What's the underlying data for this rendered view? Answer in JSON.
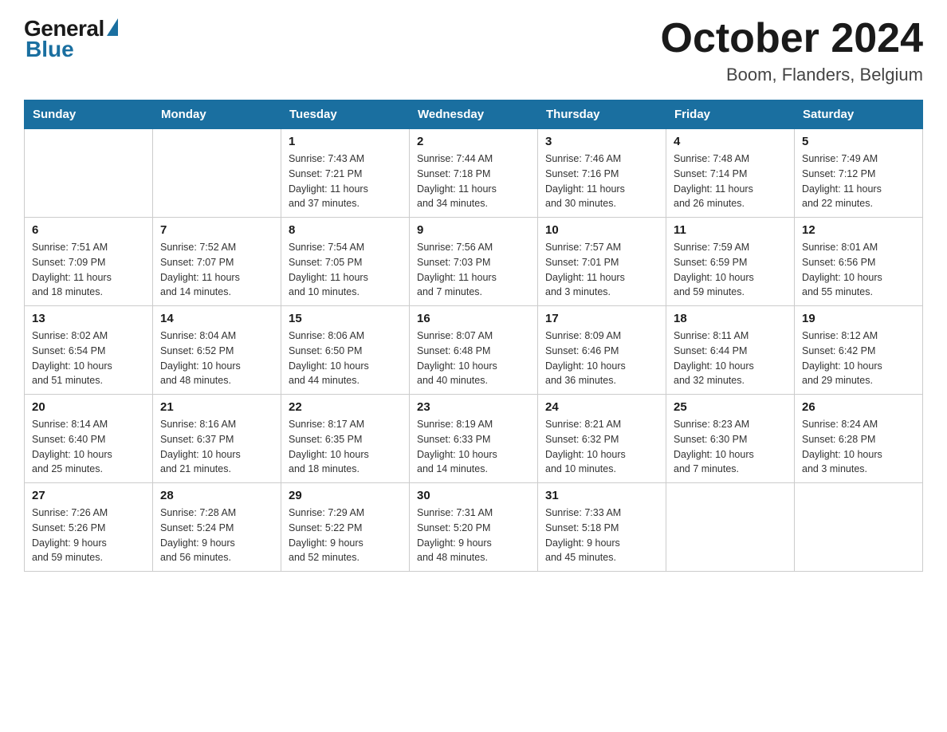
{
  "logo": {
    "general": "General",
    "blue": "Blue"
  },
  "header": {
    "month": "October 2024",
    "location": "Boom, Flanders, Belgium"
  },
  "weekdays": [
    "Sunday",
    "Monday",
    "Tuesday",
    "Wednesday",
    "Thursday",
    "Friday",
    "Saturday"
  ],
  "weeks": [
    [
      {
        "day": "",
        "info": ""
      },
      {
        "day": "",
        "info": ""
      },
      {
        "day": "1",
        "info": "Sunrise: 7:43 AM\nSunset: 7:21 PM\nDaylight: 11 hours\nand 37 minutes."
      },
      {
        "day": "2",
        "info": "Sunrise: 7:44 AM\nSunset: 7:18 PM\nDaylight: 11 hours\nand 34 minutes."
      },
      {
        "day": "3",
        "info": "Sunrise: 7:46 AM\nSunset: 7:16 PM\nDaylight: 11 hours\nand 30 minutes."
      },
      {
        "day": "4",
        "info": "Sunrise: 7:48 AM\nSunset: 7:14 PM\nDaylight: 11 hours\nand 26 minutes."
      },
      {
        "day": "5",
        "info": "Sunrise: 7:49 AM\nSunset: 7:12 PM\nDaylight: 11 hours\nand 22 minutes."
      }
    ],
    [
      {
        "day": "6",
        "info": "Sunrise: 7:51 AM\nSunset: 7:09 PM\nDaylight: 11 hours\nand 18 minutes."
      },
      {
        "day": "7",
        "info": "Sunrise: 7:52 AM\nSunset: 7:07 PM\nDaylight: 11 hours\nand 14 minutes."
      },
      {
        "day": "8",
        "info": "Sunrise: 7:54 AM\nSunset: 7:05 PM\nDaylight: 11 hours\nand 10 minutes."
      },
      {
        "day": "9",
        "info": "Sunrise: 7:56 AM\nSunset: 7:03 PM\nDaylight: 11 hours\nand 7 minutes."
      },
      {
        "day": "10",
        "info": "Sunrise: 7:57 AM\nSunset: 7:01 PM\nDaylight: 11 hours\nand 3 minutes."
      },
      {
        "day": "11",
        "info": "Sunrise: 7:59 AM\nSunset: 6:59 PM\nDaylight: 10 hours\nand 59 minutes."
      },
      {
        "day": "12",
        "info": "Sunrise: 8:01 AM\nSunset: 6:56 PM\nDaylight: 10 hours\nand 55 minutes."
      }
    ],
    [
      {
        "day": "13",
        "info": "Sunrise: 8:02 AM\nSunset: 6:54 PM\nDaylight: 10 hours\nand 51 minutes."
      },
      {
        "day": "14",
        "info": "Sunrise: 8:04 AM\nSunset: 6:52 PM\nDaylight: 10 hours\nand 48 minutes."
      },
      {
        "day": "15",
        "info": "Sunrise: 8:06 AM\nSunset: 6:50 PM\nDaylight: 10 hours\nand 44 minutes."
      },
      {
        "day": "16",
        "info": "Sunrise: 8:07 AM\nSunset: 6:48 PM\nDaylight: 10 hours\nand 40 minutes."
      },
      {
        "day": "17",
        "info": "Sunrise: 8:09 AM\nSunset: 6:46 PM\nDaylight: 10 hours\nand 36 minutes."
      },
      {
        "day": "18",
        "info": "Sunrise: 8:11 AM\nSunset: 6:44 PM\nDaylight: 10 hours\nand 32 minutes."
      },
      {
        "day": "19",
        "info": "Sunrise: 8:12 AM\nSunset: 6:42 PM\nDaylight: 10 hours\nand 29 minutes."
      }
    ],
    [
      {
        "day": "20",
        "info": "Sunrise: 8:14 AM\nSunset: 6:40 PM\nDaylight: 10 hours\nand 25 minutes."
      },
      {
        "day": "21",
        "info": "Sunrise: 8:16 AM\nSunset: 6:37 PM\nDaylight: 10 hours\nand 21 minutes."
      },
      {
        "day": "22",
        "info": "Sunrise: 8:17 AM\nSunset: 6:35 PM\nDaylight: 10 hours\nand 18 minutes."
      },
      {
        "day": "23",
        "info": "Sunrise: 8:19 AM\nSunset: 6:33 PM\nDaylight: 10 hours\nand 14 minutes."
      },
      {
        "day": "24",
        "info": "Sunrise: 8:21 AM\nSunset: 6:32 PM\nDaylight: 10 hours\nand 10 minutes."
      },
      {
        "day": "25",
        "info": "Sunrise: 8:23 AM\nSunset: 6:30 PM\nDaylight: 10 hours\nand 7 minutes."
      },
      {
        "day": "26",
        "info": "Sunrise: 8:24 AM\nSunset: 6:28 PM\nDaylight: 10 hours\nand 3 minutes."
      }
    ],
    [
      {
        "day": "27",
        "info": "Sunrise: 7:26 AM\nSunset: 5:26 PM\nDaylight: 9 hours\nand 59 minutes."
      },
      {
        "day": "28",
        "info": "Sunrise: 7:28 AM\nSunset: 5:24 PM\nDaylight: 9 hours\nand 56 minutes."
      },
      {
        "day": "29",
        "info": "Sunrise: 7:29 AM\nSunset: 5:22 PM\nDaylight: 9 hours\nand 52 minutes."
      },
      {
        "day": "30",
        "info": "Sunrise: 7:31 AM\nSunset: 5:20 PM\nDaylight: 9 hours\nand 48 minutes."
      },
      {
        "day": "31",
        "info": "Sunrise: 7:33 AM\nSunset: 5:18 PM\nDaylight: 9 hours\nand 45 minutes."
      },
      {
        "day": "",
        "info": ""
      },
      {
        "day": "",
        "info": ""
      }
    ]
  ]
}
